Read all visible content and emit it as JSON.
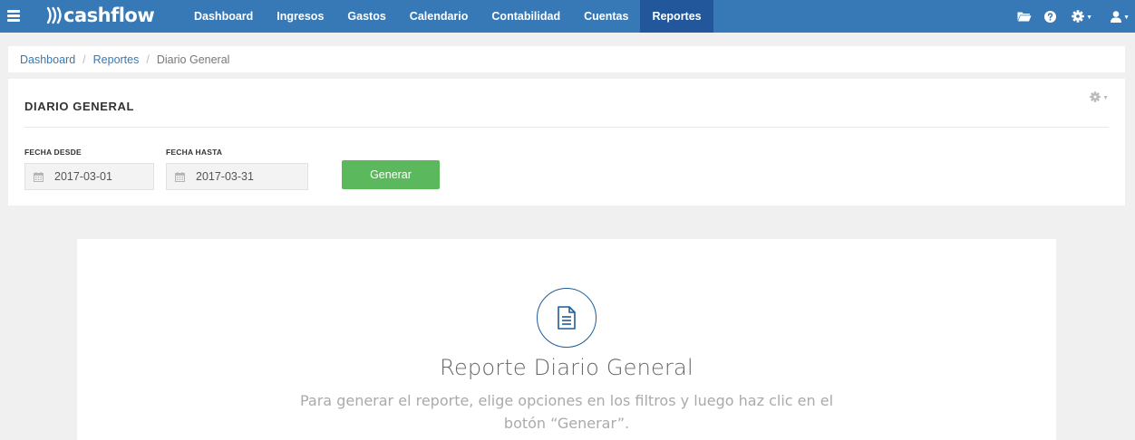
{
  "app": {
    "brand": "cashflow"
  },
  "nav": {
    "items": [
      {
        "label": "Dashboard"
      },
      {
        "label": "Ingresos"
      },
      {
        "label": "Gastos"
      },
      {
        "label": "Calendario"
      },
      {
        "label": "Contabilidad"
      },
      {
        "label": "Cuentas"
      },
      {
        "label": "Reportes",
        "active": true
      }
    ],
    "right_icons": [
      "folder-icon",
      "help-icon",
      "gear-icon",
      "user-icon"
    ]
  },
  "breadcrumb": {
    "items": [
      {
        "label": "Dashboard"
      },
      {
        "label": "Reportes"
      }
    ],
    "separator": "/",
    "current": "Diario General"
  },
  "panel": {
    "title": "DIARIO GENERAL",
    "filters": {
      "from": {
        "label": "FECHA DESDE",
        "value": "2017-03-01"
      },
      "to": {
        "label": "FECHA HASTA",
        "value": "2017-03-31"
      }
    },
    "generate_label": "Generar"
  },
  "empty_state": {
    "icon": "document-icon",
    "title": "Reporte Diario General",
    "description": "Para generar el reporte, elige opciones en los filtros y luego haz clic en el botón “Generar”."
  },
  "colors": {
    "navbar": "#3778b6",
    "nav_active": "#22589b",
    "button_green": "#5cb85c",
    "link": "#3778b6",
    "icon_blue": "#1f5c99"
  }
}
